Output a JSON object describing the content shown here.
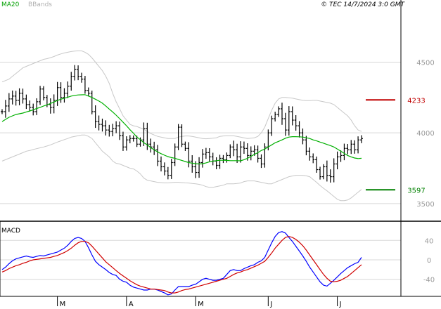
{
  "header": {
    "ma_label": "MA20",
    "bb_label": "BBands",
    "copyright": "© TEC 14/7/2024 3:0 GMT"
  },
  "colors": {
    "ma": "#00b000",
    "bbands": "#c8c8c8",
    "bars": "#000000",
    "macd": "#0000ff",
    "signal": "#d00000",
    "resistance": "#c00000",
    "support": "#008000",
    "grid": "#d8d8d8"
  },
  "chart_data": [
    {
      "type": "ohlc",
      "title": "",
      "ylim": [
        3380,
        4880
      ],
      "yticks": [
        3500,
        4000,
        4500
      ],
      "ytick_labels": [
        "3500",
        "4000",
        "4500"
      ],
      "month_labels": [
        {
          "label": "M",
          "index": 16
        },
        {
          "label": "A",
          "index": 36
        },
        {
          "label": "M",
          "index": 56
        },
        {
          "label": "J",
          "index": 77
        },
        {
          "label": "J",
          "index": 97
        }
      ],
      "levels": [
        {
          "name": "resistance",
          "value": 4233,
          "label": "4233"
        },
        {
          "name": "support",
          "value": 3597,
          "label": "3597"
        }
      ],
      "close": [
        4150,
        4190,
        4240,
        4260,
        4230,
        4280,
        4240,
        4200,
        4180,
        4150,
        4220,
        4310,
        4250,
        4200,
        4180,
        4230,
        4320,
        4250,
        4280,
        4330,
        4400,
        4450,
        4400,
        4380,
        4300,
        4280,
        4150,
        4080,
        4060,
        4050,
        4020,
        4010,
        4030,
        4050,
        3980,
        3900,
        3950,
        3960,
        3960,
        3920,
        3950,
        4030,
        3920,
        3900,
        3880,
        3800,
        3760,
        3730,
        3700,
        3790,
        3900,
        4040,
        3920,
        3890,
        3800,
        3760,
        3720,
        3790,
        3850,
        3860,
        3830,
        3800,
        3770,
        3820,
        3810,
        3840,
        3900,
        3880,
        3830,
        3900,
        3890,
        3840,
        3870,
        3880,
        3820,
        3780,
        3900,
        4000,
        4100,
        4130,
        4170,
        4100,
        4020,
        4150,
        4090,
        4050,
        4000,
        3950,
        3870,
        3830,
        3810,
        3740,
        3690,
        3760,
        3700,
        3690,
        3780,
        3830,
        3840,
        3890,
        3880,
        3920,
        3880,
        3950,
        3960
      ],
      "ma20": [
        4080,
        4095,
        4110,
        4120,
        4130,
        4135,
        4140,
        4148,
        4155,
        4163,
        4172,
        4180,
        4190,
        4198,
        4208,
        4218,
        4229,
        4238,
        4245,
        4252,
        4260,
        4265,
        4268,
        4269,
        4270,
        4260,
        4250,
        4238,
        4225,
        4210,
        4190,
        4168,
        4148,
        4125,
        4100,
        4075,
        4050,
        4022,
        3998,
        3970,
        3952,
        3930,
        3915,
        3895,
        3880,
        3865,
        3853,
        3842,
        3832,
        3825,
        3820,
        3812,
        3805,
        3797,
        3790,
        3786,
        3782,
        3780,
        3782,
        3788,
        3795,
        3800,
        3803,
        3806,
        3806,
        3805,
        3803,
        3803,
        3803,
        3802,
        3810,
        3820,
        3834,
        3848,
        3860,
        3875,
        3885,
        3900,
        3915,
        3930,
        3940,
        3950,
        3962,
        3970,
        3973,
        3973,
        3972,
        3970,
        3965,
        3960,
        3950,
        3943,
        3935,
        3927,
        3918,
        3910,
        3900,
        3885,
        3870,
        3855,
        3840,
        3830,
        3822,
        3818,
        3820
      ],
      "bb_upper": [
        4360,
        4370,
        4380,
        4400,
        4420,
        4440,
        4460,
        4470,
        4480,
        4490,
        4500,
        4510,
        4520,
        4525,
        4532,
        4540,
        4550,
        4558,
        4565,
        4570,
        4575,
        4578,
        4580,
        4580,
        4570,
        4555,
        4530,
        4500,
        4470,
        4440,
        4400,
        4350,
        4280,
        4220,
        4170,
        4120,
        4090,
        4060,
        4050,
        4045,
        4035,
        4025,
        4010,
        3995,
        3985,
        3975,
        3970,
        3965,
        3960,
        3960,
        3960,
        3970,
        3975,
        3978,
        3978,
        3975,
        3970,
        3965,
        3960,
        3958,
        3960,
        3962,
        3965,
        3975,
        3978,
        3979,
        3979,
        3979,
        3975,
        3970,
        3965,
        3960,
        3962,
        3965,
        3975,
        4000,
        4040,
        4100,
        4160,
        4210,
        4240,
        4250,
        4250,
        4248,
        4245,
        4240,
        4235,
        4230,
        4228,
        4228,
        4230,
        4230,
        4225,
        4220,
        4215,
        4210,
        4200,
        4180,
        4160,
        4140,
        4120,
        4090,
        4050,
        4020,
        4010
      ],
      "bb_lower": [
        3800,
        3810,
        3820,
        3830,
        3840,
        3850,
        3860,
        3870,
        3875,
        3882,
        3888,
        3894,
        3900,
        3907,
        3915,
        3925,
        3935,
        3943,
        3952,
        3960,
        3970,
        3975,
        3980,
        3985,
        3985,
        3975,
        3960,
        3930,
        3900,
        3870,
        3850,
        3830,
        3800,
        3785,
        3780,
        3770,
        3760,
        3750,
        3745,
        3730,
        3710,
        3680,
        3665,
        3660,
        3655,
        3650,
        3648,
        3646,
        3646,
        3648,
        3650,
        3650,
        3648,
        3646,
        3645,
        3642,
        3640,
        3636,
        3630,
        3620,
        3615,
        3615,
        3620,
        3625,
        3630,
        3640,
        3640,
        3640,
        3642,
        3645,
        3655,
        3660,
        3660,
        3660,
        3655,
        3650,
        3645,
        3640,
        3640,
        3650,
        3660,
        3670,
        3680,
        3690,
        3695,
        3700,
        3700,
        3700,
        3696,
        3690,
        3670,
        3650,
        3628,
        3608,
        3590,
        3570,
        3550,
        3530,
        3520,
        3520,
        3525,
        3540,
        3560,
        3580,
        3600
      ]
    },
    {
      "type": "line",
      "title": "MACD",
      "ylim": [
        -75,
        75
      ],
      "yticks": [
        40,
        0,
        -40
      ],
      "ytick_labels": [
        "40",
        "0",
        "-40"
      ],
      "series": [
        {
          "name": "",
          "color_key": "macd",
          "values": [
            -20,
            -15,
            -8,
            -2,
            2,
            4,
            6,
            8,
            6,
            5,
            7,
            9,
            8,
            10,
            12,
            14,
            16,
            20,
            24,
            30,
            38,
            44,
            46,
            44,
            38,
            25,
            10,
            -3,
            -10,
            -15,
            -20,
            -26,
            -30,
            -32,
            -40,
            -44,
            -46,
            -52,
            -56,
            -58,
            -60,
            -62,
            -62,
            -60,
            -60,
            -62,
            -65,
            -68,
            -72,
            -70,
            -62,
            -55,
            -55,
            -55,
            -55,
            -52,
            -50,
            -45,
            -40,
            -38,
            -40,
            -42,
            -42,
            -40,
            -38,
            -30,
            -22,
            -20,
            -22,
            -22,
            -18,
            -15,
            -12,
            -10,
            -5,
            -2,
            5,
            20,
            35,
            48,
            56,
            58,
            55,
            46,
            38,
            28,
            18,
            8,
            -3,
            -15,
            -25,
            -35,
            -45,
            -52,
            -54,
            -48,
            -42,
            -35,
            -28,
            -22,
            -16,
            -12,
            -8,
            -5,
            5
          ]
        },
        {
          "name": "",
          "color_key": "signal",
          "values": [
            -25,
            -22,
            -18,
            -15,
            -12,
            -10,
            -7,
            -5,
            -2,
            0,
            1,
            2,
            3,
            4,
            5,
            7,
            9,
            12,
            15,
            19,
            24,
            30,
            35,
            38,
            38,
            35,
            28,
            20,
            12,
            4,
            -4,
            -10,
            -16,
            -22,
            -28,
            -33,
            -38,
            -43,
            -47,
            -51,
            -54,
            -56,
            -58,
            -60,
            -60,
            -61,
            -62,
            -63,
            -66,
            -68,
            -68,
            -66,
            -63,
            -61,
            -60,
            -58,
            -56,
            -54,
            -52,
            -50,
            -48,
            -46,
            -44,
            -42,
            -40,
            -38,
            -34,
            -30,
            -27,
            -25,
            -22,
            -20,
            -17,
            -14,
            -11,
            -7,
            -3,
            5,
            14,
            24,
            32,
            40,
            46,
            48,
            46,
            42,
            36,
            29,
            20,
            10,
            0,
            -10,
            -20,
            -30,
            -38,
            -44,
            -45,
            -44,
            -42,
            -38,
            -34,
            -28,
            -22,
            -16,
            -10
          ]
        }
      ]
    }
  ]
}
